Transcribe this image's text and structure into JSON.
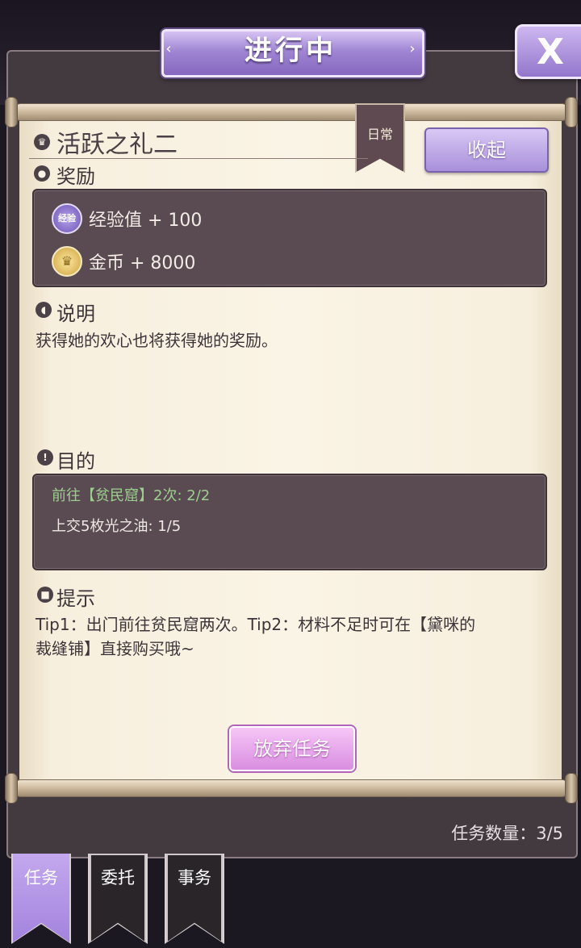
{
  "header": {
    "title": "进行中",
    "close_label": "X"
  },
  "quest": {
    "title": "活跃之礼二",
    "category": "日常",
    "collapse_label": "收起",
    "rewards": {
      "label": "奖励",
      "items": [
        {
          "icon": "exp-badge-icon",
          "icon_text": "经验",
          "text": "经验值 + 100"
        },
        {
          "icon": "gold-coin-icon",
          "text": "金币 + 8000"
        }
      ]
    },
    "description": {
      "label": "说明",
      "text": "获得她的欢心也将获得她的奖励。"
    },
    "objective": {
      "label": "目的",
      "items": [
        {
          "text": "前往【贫民窟】2次: 2/2",
          "completed": true,
          "color": "#9ccf8f"
        },
        {
          "text": "上交5枚光之油: 1/5",
          "completed": false,
          "color": "#f0e8e4"
        }
      ]
    },
    "hint": {
      "label": "提示",
      "line1": "Tip1：出门前往贫民窟两次。Tip2：材料不足时可在【黛咪的",
      "line2": "裁缝铺】直接购买哦~"
    },
    "abandon_label": "放弃任务"
  },
  "quest_count": "任务数量：3/5",
  "tabs": [
    {
      "label": "任务",
      "active": true
    },
    {
      "label": "委托",
      "active": false
    },
    {
      "label": "事务",
      "active": false
    }
  ],
  "colors": {
    "accent": "#a383de",
    "panel": "#5a4b52",
    "parchment": "#faf4e6"
  }
}
